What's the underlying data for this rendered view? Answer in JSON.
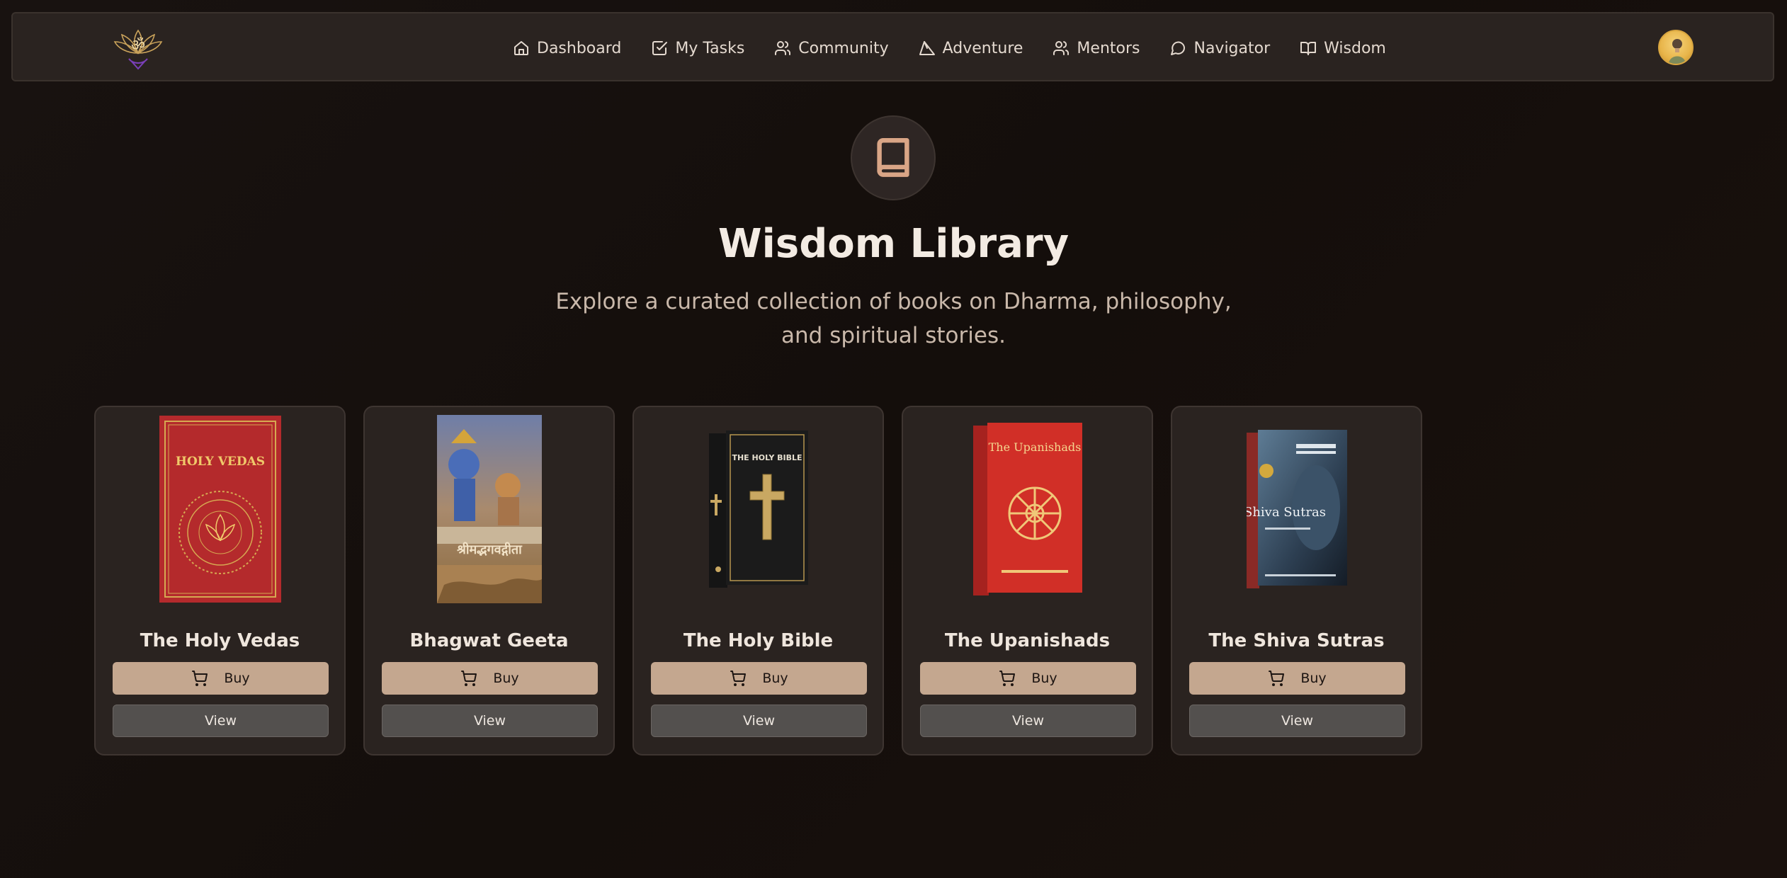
{
  "nav": {
    "items": [
      {
        "label": "Dashboard",
        "icon": "home-icon"
      },
      {
        "label": "My Tasks",
        "icon": "checkbox-icon"
      },
      {
        "label": "Community",
        "icon": "users-icon"
      },
      {
        "label": "Adventure",
        "icon": "mountain-icon"
      },
      {
        "label": "Mentors",
        "icon": "users-icon"
      },
      {
        "label": "Navigator",
        "icon": "message-circle-icon"
      },
      {
        "label": "Wisdom",
        "icon": "book-open-icon"
      }
    ]
  },
  "hero": {
    "icon": "book-icon",
    "title": "Wisdom Library",
    "subtitle": "Explore a curated collection of books on Dharma, philosophy, and spiritual stories."
  },
  "books": [
    {
      "title": "The Holy Vedas",
      "cover_text": "HOLY VEDAS",
      "buy_label": "Buy",
      "view_label": "View"
    },
    {
      "title": "Bhagwat Geeta",
      "cover_text": "श्रीमद्भगवद्गीता",
      "buy_label": "Buy",
      "view_label": "View"
    },
    {
      "title": "The Holy Bible",
      "cover_text": "THE HOLY BIBLE",
      "buy_label": "Buy",
      "view_label": "View"
    },
    {
      "title": "The Upanishads",
      "cover_text": "The Upanishads",
      "buy_label": "Buy",
      "view_label": "View"
    },
    {
      "title": "The Shiva Sutras",
      "cover_text": "Shiva Sutras",
      "buy_label": "Buy",
      "view_label": "View"
    }
  ],
  "colors": {
    "background": "#150f0c",
    "card": "#2a2320",
    "buy_button": "#c4a78f",
    "view_button": "#53504e",
    "accent_icon": "#d9a586"
  }
}
